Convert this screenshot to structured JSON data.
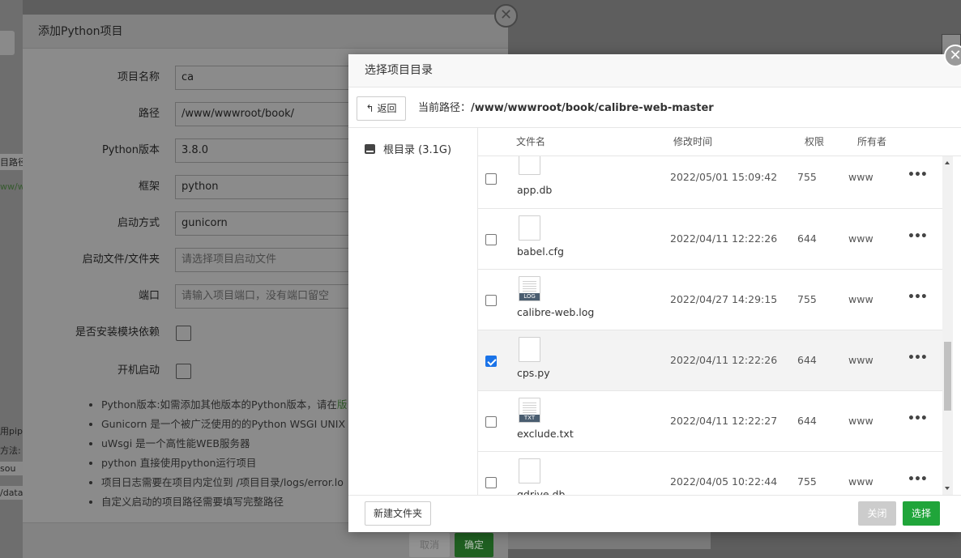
{
  "background": {
    "left_texts": [
      "目路径",
      "ww/w",
      "用pip",
      "方法:",
      "sou",
      "/data"
    ]
  },
  "add_dialog": {
    "title": "添加Python项目",
    "fields": [
      {
        "label": "项目名称",
        "value": "ca",
        "placeholder": ""
      },
      {
        "label": "路径",
        "value": "/www/wwwroot/book/",
        "placeholder": ""
      },
      {
        "label": "Python版本",
        "value": "3.8.0",
        "placeholder": ""
      },
      {
        "label": "框架",
        "value": "python",
        "placeholder": ""
      },
      {
        "label": "启动方式",
        "value": "gunicorn",
        "placeholder": ""
      },
      {
        "label": "启动文件/文件夹",
        "value": "",
        "placeholder": "请选择项目启动文件"
      },
      {
        "label": "端口",
        "value": "",
        "placeholder": "请输入项目端口，没有端口留空"
      }
    ],
    "checks": [
      {
        "label": "是否安装模块依赖",
        "checked": false
      },
      {
        "label": "开机启动",
        "checked": false
      }
    ],
    "tips": [
      {
        "text": "Python版本:如需添加其他版本的Python版本，请在",
        "link": "版"
      },
      {
        "text": "Gunicorn 是一个被广泛使用的的Python WSGI UNIX",
        "link": ""
      },
      {
        "text": "uWsgi 是一个高性能WEB服务器",
        "link": ""
      },
      {
        "text": "python 直接使用python运行项目",
        "link": ""
      },
      {
        "text": "项目日志需要在项目内定位到 /项目目录/logs/error.lo",
        "link": ""
      },
      {
        "text": "自定义启动的项目路径需要填写完整路径",
        "link": ""
      }
    ],
    "cancel_label": "取消",
    "ok_label": "确定"
  },
  "picker": {
    "title": "选择项目目录",
    "back_label": "返回",
    "path_prefix": "当前路径：",
    "path": "/www/wwwroot/book/calibre-web-master",
    "root_label": "根目录 (3.1G)",
    "columns": {
      "name": "文件名",
      "mtime": "修改时间",
      "perm": "权限",
      "owner": "所有者"
    },
    "files": [
      {
        "name": "app.db",
        "mtime": "2022/05/01 15:09:42",
        "perm": "755",
        "owner": "www",
        "icon": "file",
        "checked": false
      },
      {
        "name": "babel.cfg",
        "mtime": "2022/04/11 12:22:26",
        "perm": "644",
        "owner": "www",
        "icon": "file",
        "checked": false
      },
      {
        "name": "calibre-web.log",
        "mtime": "2022/04/27 14:29:15",
        "perm": "755",
        "owner": "www",
        "icon": "LOG",
        "checked": false
      },
      {
        "name": "cps.py",
        "mtime": "2022/04/11 12:22:26",
        "perm": "644",
        "owner": "www",
        "icon": "file",
        "checked": true
      },
      {
        "name": "exclude.txt",
        "mtime": "2022/04/11 12:22:27",
        "perm": "644",
        "owner": "www",
        "icon": "TXT",
        "checked": false
      },
      {
        "name": "gdrive.db",
        "mtime": "2022/04/05 10:22:44",
        "perm": "755",
        "owner": "www",
        "icon": "file",
        "checked": false
      }
    ],
    "more_label": "•••",
    "new_folder_label": "新建文件夹",
    "close_label": "关闭",
    "select_label": "选择"
  },
  "colors": {
    "accent": "#20a53a",
    "checkbox": "#1a73e8"
  }
}
